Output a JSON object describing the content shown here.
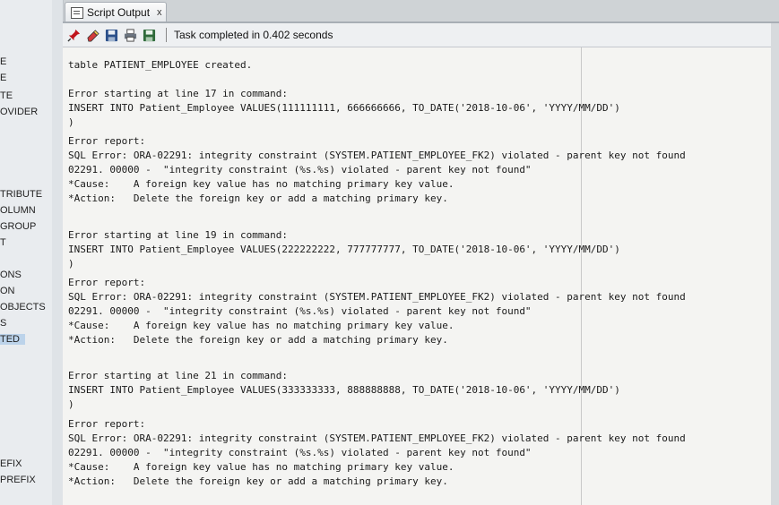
{
  "sidebar": {
    "items": [
      "E",
      "E",
      "TE",
      "OVIDER",
      "TRIBUTE",
      "OLUMN",
      "GROUP",
      "T",
      "ONS",
      "ON",
      "OBJECTS",
      "S",
      "TED",
      "EFIX",
      "PREFIX"
    ]
  },
  "tab": {
    "label": "Script Output",
    "close": "x"
  },
  "toolbar": {
    "status": "Task completed in 0.402 seconds"
  },
  "output": {
    "lines": [
      "table PATIENT_EMPLOYEE created.",
      "",
      "Error starting at line 17 in command:",
      "INSERT INTO Patient_Employee VALUES(111111111, 666666666, TO_DATE('2018-10-06', 'YYYY/MM/DD')",
      ")",
      "Error report:",
      "SQL Error: ORA-02291: integrity constraint (SYSTEM.PATIENT_EMPLOYEE_FK2) violated - parent key not found",
      "02291. 00000 -  \"integrity constraint (%s.%s) violated - parent key not found\"",
      "*Cause:    A foreign key value has no matching primary key value.",
      "*Action:   Delete the foreign key or add a matching primary key.",
      "",
      "Error starting at line 19 in command:",
      "INSERT INTO Patient_Employee VALUES(222222222, 777777777, TO_DATE('2018-10-06', 'YYYY/MM/DD')",
      ")",
      "Error report:",
      "SQL Error: ORA-02291: integrity constraint (SYSTEM.PATIENT_EMPLOYEE_FK2) violated - parent key not found",
      "02291. 00000 -  \"integrity constraint (%s.%s) violated - parent key not found\"",
      "*Cause:    A foreign key value has no matching primary key value.",
      "*Action:   Delete the foreign key or add a matching primary key.",
      "",
      "Error starting at line 21 in command:",
      "INSERT INTO Patient_Employee VALUES(333333333, 888888888, TO_DATE('2018-10-06', 'YYYY/MM/DD')",
      ")",
      "Error report:",
      "SQL Error: ORA-02291: integrity constraint (SYSTEM.PATIENT_EMPLOYEE_FK2) violated - parent key not found",
      "02291. 00000 -  \"integrity constraint (%s.%s) violated - parent key not found\"",
      "*Cause:    A foreign key value has no matching primary key value.",
      "*Action:   Delete the foreign key or add a matching primary key."
    ]
  },
  "icons": [
    "pin-icon",
    "eraser-icon",
    "save-icon",
    "print-icon",
    "save-as-icon"
  ]
}
